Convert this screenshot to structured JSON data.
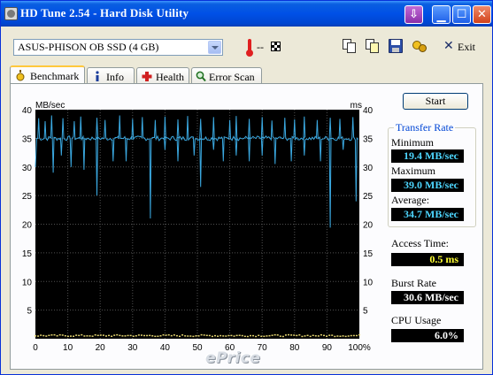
{
  "window": {
    "title": "HD Tune 2.54 - Hard Disk Utility"
  },
  "toolbar": {
    "drive": "ASUS-PHISON OB SSD (4 GB)",
    "temperature": "--",
    "exit_label": "Exit"
  },
  "tabs": [
    {
      "label": "Benchmark",
      "active": true
    },
    {
      "label": "Info",
      "active": false
    },
    {
      "label": "Health",
      "active": false
    },
    {
      "label": "Error Scan",
      "active": false
    }
  ],
  "start_button": "Start",
  "transfer_rate": {
    "title": "Transfer Rate",
    "minimum_label": "Minimum",
    "minimum": "19.4 MB/sec",
    "maximum_label": "Maximum",
    "maximum": "39.0 MB/sec",
    "average_label": "Average:",
    "average": "34.7 MB/sec"
  },
  "access_time": {
    "label": "Access Time:",
    "value": "0.5 ms"
  },
  "burst_rate": {
    "label": "Burst Rate",
    "value": "30.6 MB/sec"
  },
  "cpu_usage": {
    "label": "CPU Usage",
    "value": "6.0%"
  },
  "watermark": "ePrice",
  "colors": {
    "transfer_line": "#3aa8e0",
    "access_dots": "#e8d870",
    "chart_bg": "#000000",
    "grid": "#505050"
  },
  "chart_data": {
    "type": "line",
    "y_left_label": "MB/sec",
    "y_right_label": "ms",
    "y_left_ticks": [
      "40",
      "35",
      "30",
      "25",
      "20",
      "15",
      "10",
      "5"
    ],
    "y_right_ticks": [
      "40",
      "35",
      "30",
      "25",
      "20",
      "15",
      "10",
      "5"
    ],
    "x_ticks": [
      "0",
      "10",
      "20",
      "30",
      "40",
      "50",
      "60",
      "70",
      "80",
      "90",
      "100%"
    ],
    "ylim": [
      0,
      40
    ],
    "xlim": [
      0,
      100
    ],
    "grid": true,
    "baseline_mbps": 35,
    "spikes_up": [
      [
        1,
        38.5
      ],
      [
        3,
        38
      ],
      [
        5,
        39
      ],
      [
        8.5,
        38.5
      ],
      [
        12,
        38
      ],
      [
        14,
        38.8
      ],
      [
        19,
        38.6
      ],
      [
        21.5,
        38.2
      ],
      [
        26,
        39
      ],
      [
        30,
        38.4
      ],
      [
        33,
        38.7
      ],
      [
        37,
        38.2
      ],
      [
        40,
        38.8
      ],
      [
        44,
        38.3
      ],
      [
        47,
        38.9
      ],
      [
        51,
        38.4
      ],
      [
        55,
        38.7
      ],
      [
        60,
        38.2
      ],
      [
        62,
        38.9
      ],
      [
        66,
        38.4
      ],
      [
        70,
        38.7
      ],
      [
        73,
        38.1
      ],
      [
        77,
        38.6
      ],
      [
        80,
        38.3
      ],
      [
        83,
        38.8
      ],
      [
        87,
        38.2
      ],
      [
        91,
        38.6
      ],
      [
        94,
        38.4
      ],
      [
        98,
        38.7
      ]
    ],
    "spikes_down": [
      [
        5.5,
        29
      ],
      [
        8,
        32
      ],
      [
        11,
        30
      ],
      [
        15,
        29.5
      ],
      [
        19,
        25
      ],
      [
        24,
        31
      ],
      [
        28,
        31
      ],
      [
        35.5,
        21
      ],
      [
        40,
        33
      ],
      [
        44,
        31
      ],
      [
        49,
        32
      ],
      [
        51,
        26.5
      ],
      [
        55,
        33
      ],
      [
        58,
        31
      ],
      [
        62,
        32
      ],
      [
        66,
        31
      ],
      [
        70,
        32
      ],
      [
        74,
        30.5
      ],
      [
        79,
        31
      ],
      [
        83,
        32
      ],
      [
        88,
        31
      ],
      [
        91,
        19.4
      ],
      [
        95,
        33
      ],
      [
        99,
        24
      ]
    ],
    "access_time_ms": 0.5
  }
}
